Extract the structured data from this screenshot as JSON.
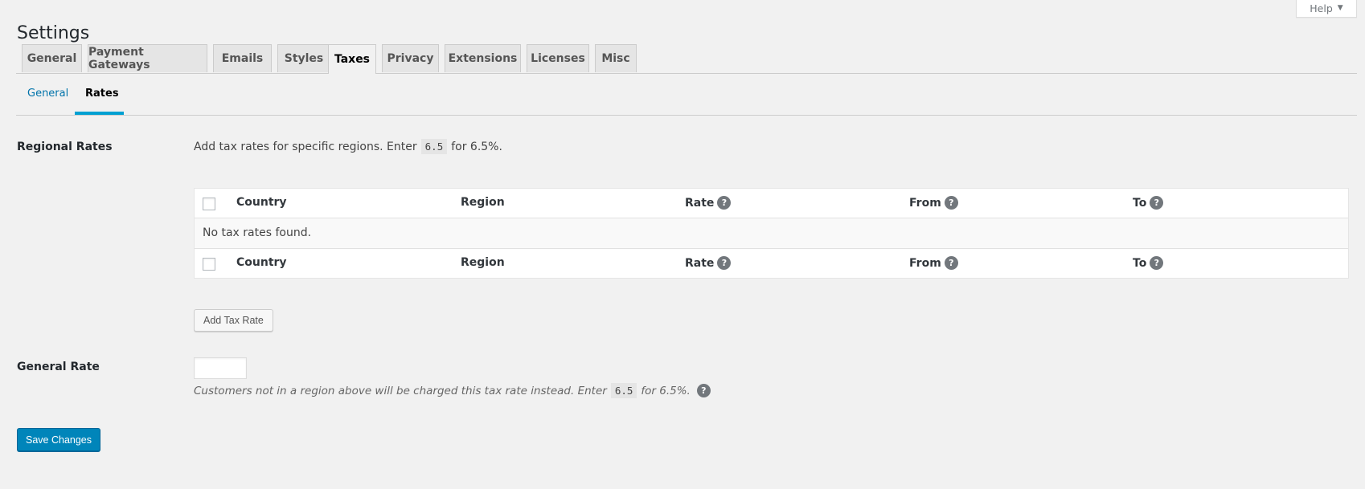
{
  "page": {
    "title": "Settings"
  },
  "help": {
    "label": "Help"
  },
  "tabs": [
    {
      "label": "General"
    },
    {
      "label": "Payment Gateways"
    },
    {
      "label": "Emails"
    },
    {
      "label": "Styles"
    },
    {
      "label": "Taxes"
    },
    {
      "label": "Privacy"
    },
    {
      "label": "Extensions"
    },
    {
      "label": "Licenses"
    },
    {
      "label": "Misc"
    }
  ],
  "active_tab": "Taxes",
  "subtabs": [
    {
      "label": "General"
    },
    {
      "label": "Rates"
    }
  ],
  "active_subtab": "Rates",
  "regional_rates": {
    "label": "Regional Rates",
    "description_before": "Add tax rates for specific regions. Enter",
    "description_code": "6.5",
    "description_after": "for 6.5%.",
    "columns": [
      "Country",
      "Region",
      "Rate",
      "From",
      "To"
    ],
    "empty_message": "No tax rates found.",
    "add_button": "Add Tax Rate"
  },
  "general_rate": {
    "label": "General Rate",
    "value": "",
    "description_before": "Customers not in a region above will be charged this tax rate instead. Enter",
    "description_code": "6.5",
    "description_after": "for 6.5%."
  },
  "save_button": "Save Changes",
  "icons": {
    "help_tip": "question-circle-icon",
    "caret": "caret-down-icon"
  },
  "colors": {
    "primary": "#0085ba",
    "link": "#0073aa",
    "active_underline": "#00a0d2"
  }
}
